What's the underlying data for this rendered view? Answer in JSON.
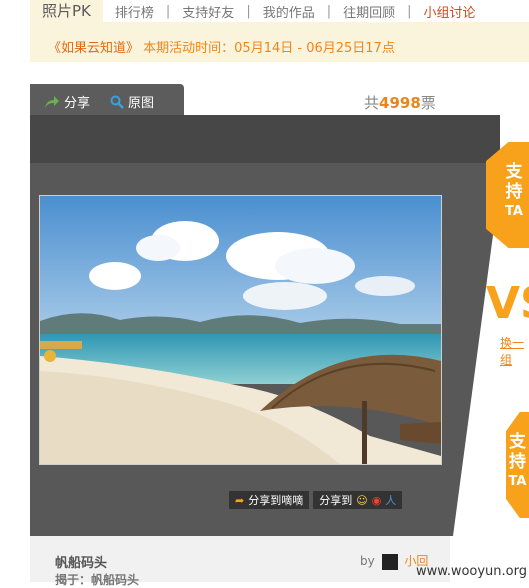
{
  "tabs": {
    "active": "照片PK",
    "items": [
      "排行榜",
      "支持好友",
      "我的作品",
      "往期回顾"
    ],
    "hot": "小组讨论",
    "separator": "|"
  },
  "announcement": {
    "name": "《如果云知道》",
    "text": "本期活动时间：05月14日 - 06月25日17点"
  },
  "card": {
    "share_tab": "分享",
    "original_tab": "原图",
    "votes_prefix": "共",
    "votes_count": "4998",
    "votes_suffix": "票"
  },
  "share": {
    "weibo_btn": "分享到嘀嘀",
    "share_to": "分享到"
  },
  "meta": {
    "title": "帆船码头",
    "subtitle": "揭于：帆船码头",
    "by": "by",
    "user": "小回"
  },
  "side": {
    "support_1": "支",
    "support_2": "持",
    "support_3": "TA",
    "vs": "VS",
    "vs_link": "换一组"
  },
  "watermark": "www.wooyun.org",
  "colors": {
    "accent": "#f7a21a",
    "hot": "#d24a1d",
    "card": "#585858"
  }
}
